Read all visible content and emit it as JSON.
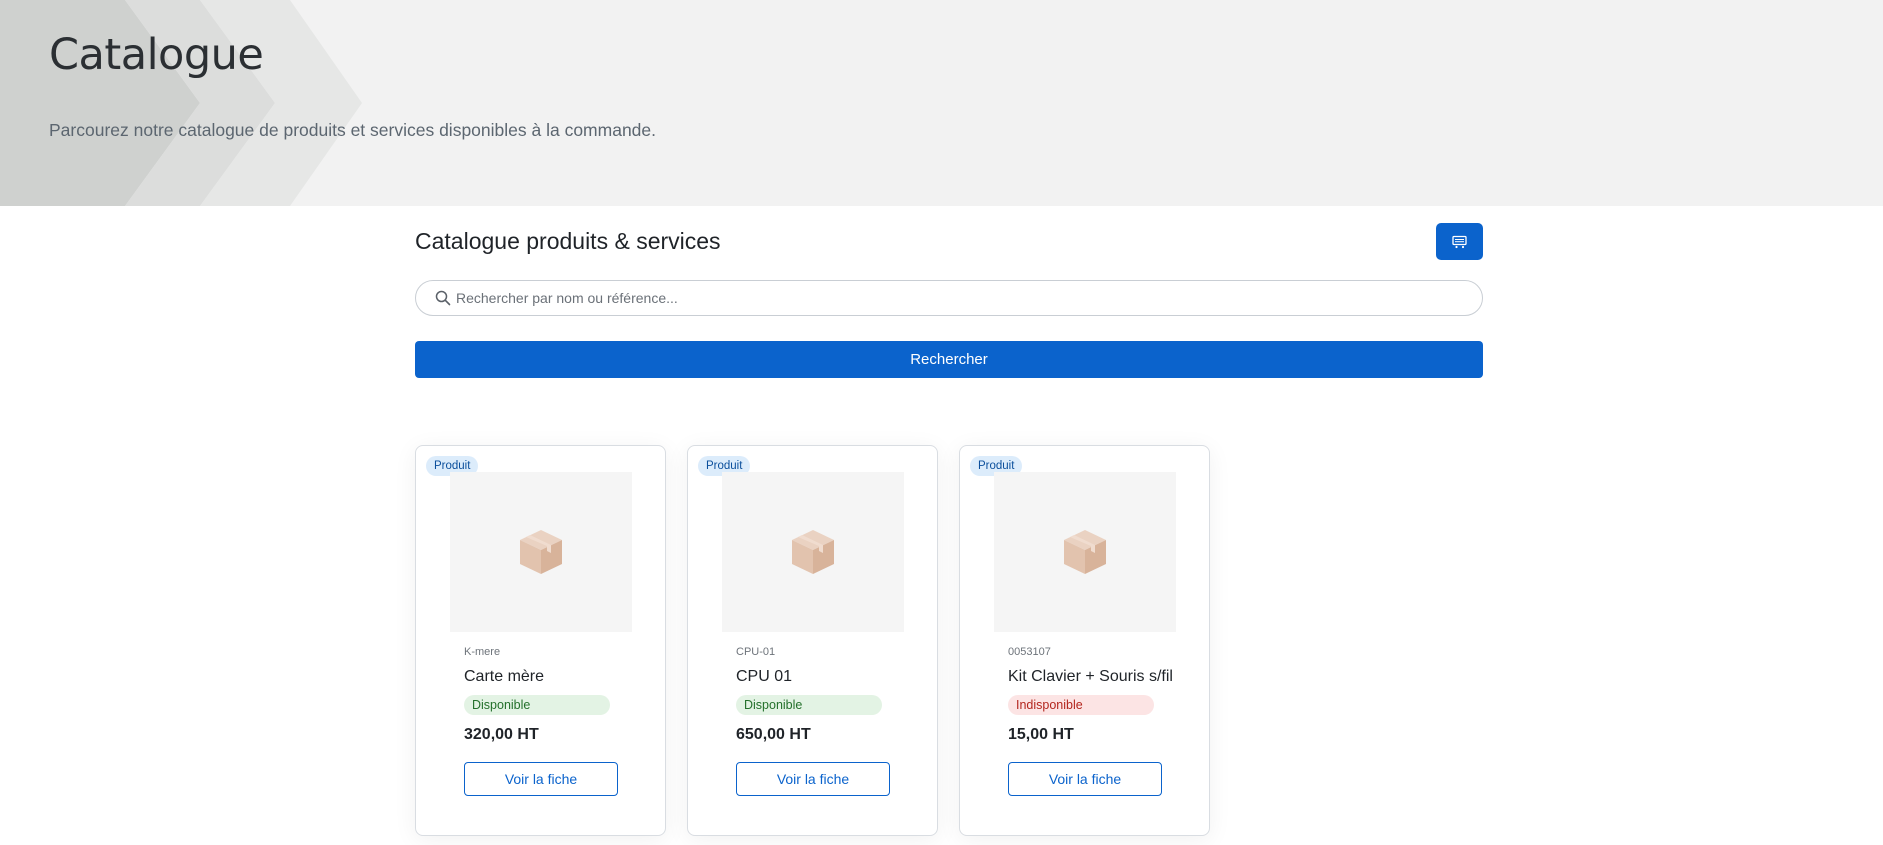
{
  "banner": {
    "title": "Catalogue",
    "subtitle": "Parcourez notre catalogue de produits et services disponibles à la commande."
  },
  "section": {
    "title": "Catalogue produits & services",
    "cart_icon": "cart-icon"
  },
  "search": {
    "placeholder": "Rechercher par nom ou référence...",
    "value": "",
    "button_label": "Rechercher",
    "icon": "search-icon"
  },
  "products": [
    {
      "type": "Produit",
      "ref": "K-mere",
      "name": "Carte mère",
      "status": "Disponible",
      "available": true,
      "price": "320,00 HT",
      "button": "Voir la fiche"
    },
    {
      "type": "Produit",
      "ref": "CPU-01",
      "name": "CPU 01",
      "status": "Disponible",
      "available": true,
      "price": "650,00 HT",
      "button": "Voir la fiche"
    },
    {
      "type": "Produit",
      "ref": "0053107",
      "name": "Kit Clavier + Souris s/fil",
      "status": "Indisponible",
      "available": false,
      "price": "15,00 HT",
      "button": "Voir la fiche"
    }
  ],
  "colors": {
    "primary": "#0b63cc",
    "banner_bg": "#f2f2f2",
    "available_bg": "#e3f3e4",
    "unavailable_bg": "#fce4e4"
  }
}
